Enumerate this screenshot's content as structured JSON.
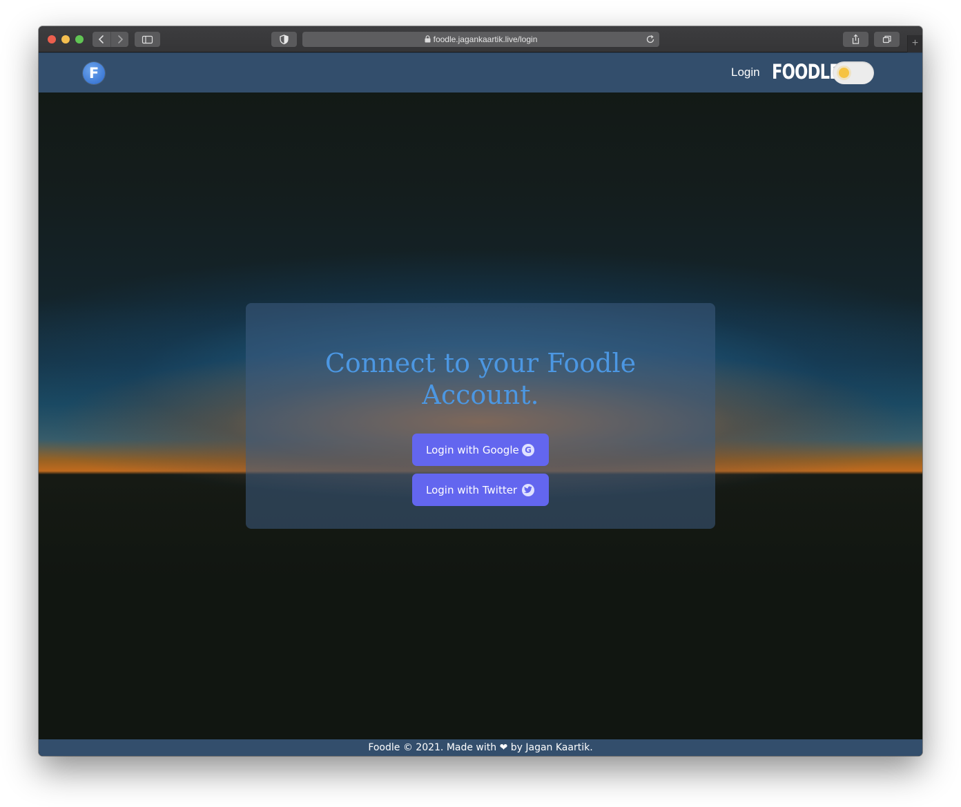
{
  "browser": {
    "url": "foodle.jagankaartik.live/login",
    "new_tab_label": "+"
  },
  "navbar": {
    "logo_letter": "F",
    "login_link": "Login",
    "brand": "FOODLE",
    "theme_toggle_state": "light"
  },
  "card": {
    "title_line1": "Connect to your Foodle",
    "title_line2": "Account.",
    "google_button": "Login with Google",
    "google_icon_letter": "G",
    "twitter_button": "Login with Twitter"
  },
  "footer": {
    "text": "Foodle © 2021. Made with ❤ by Jagan Kaartik."
  },
  "colors": {
    "navbar_bg": "#334e6c",
    "button_bg": "#6366ef",
    "title_color": "#4c97e2",
    "sun": "#f6c341"
  },
  "icons": [
    "lock-icon",
    "reload-icon",
    "shield-icon",
    "sidebar-icon",
    "share-icon",
    "tabs-icon",
    "google-icon",
    "twitter-icon",
    "sun-icon"
  ]
}
